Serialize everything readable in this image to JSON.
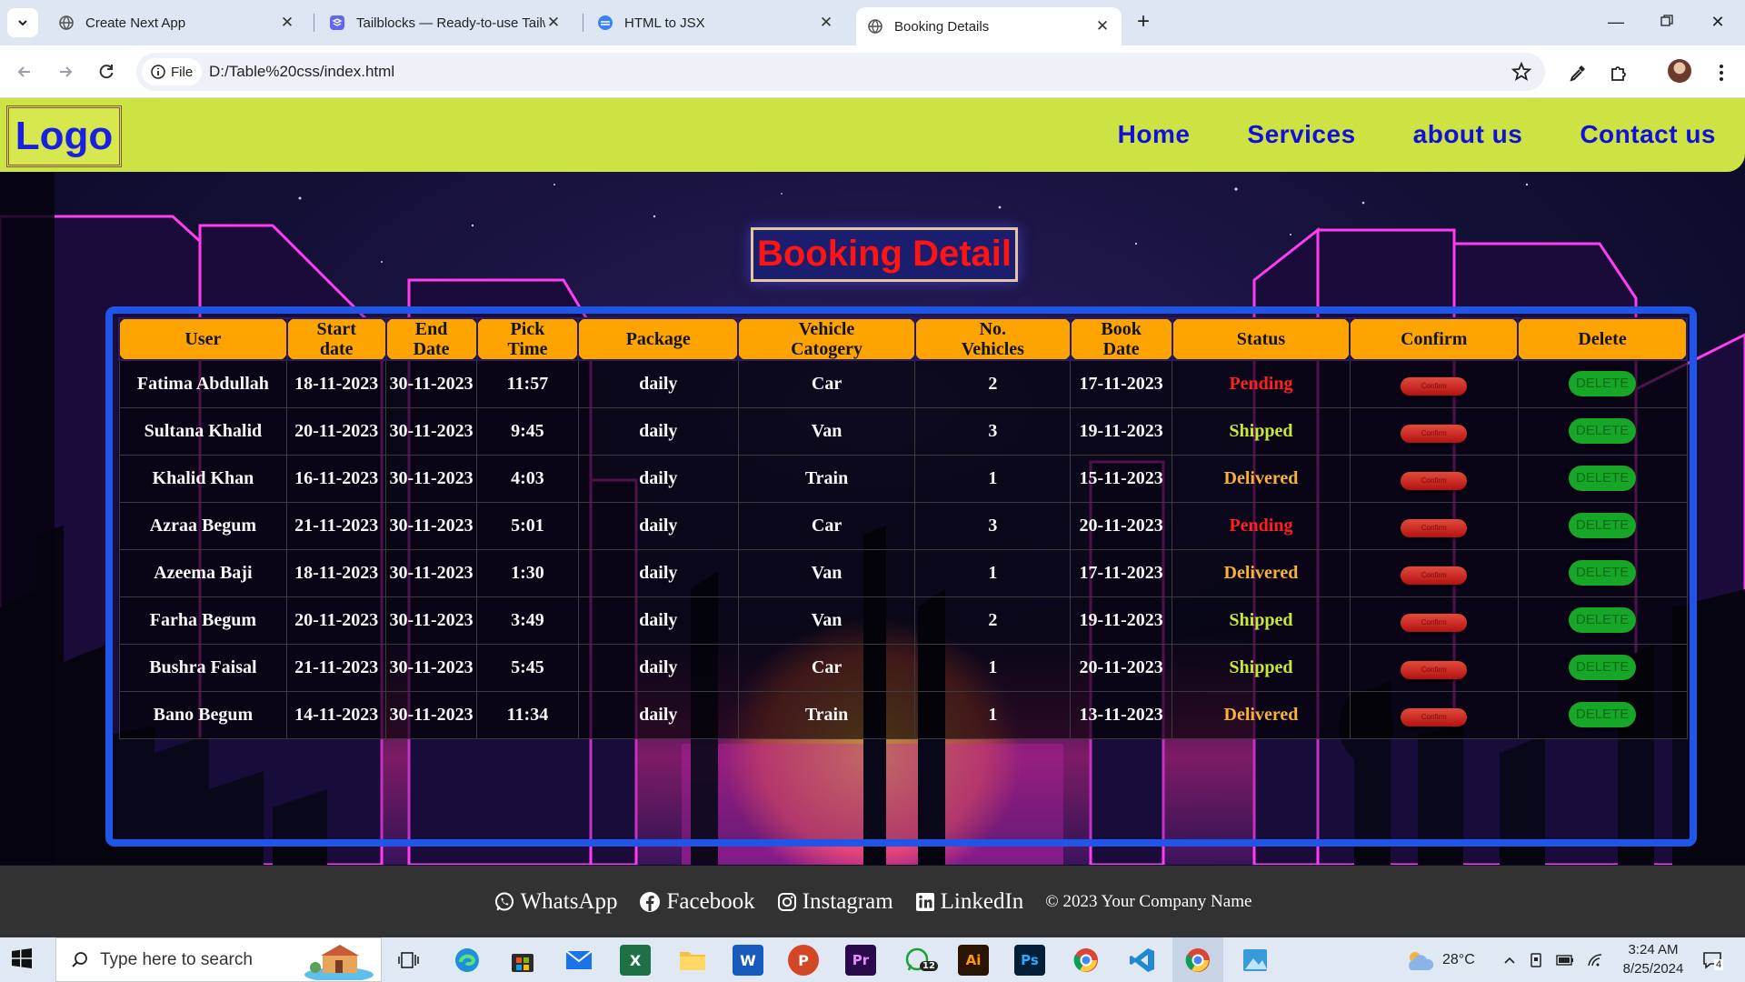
{
  "browser": {
    "tabs": [
      {
        "title": "Create Next App",
        "active": false
      },
      {
        "title": "Tailblocks — Ready-to-use Tailw",
        "active": false
      },
      {
        "title": "HTML to JSX",
        "active": false
      },
      {
        "title": "Booking Details",
        "active": true
      }
    ],
    "site_chip": "File",
    "url": "D:/Table%20css/index.html"
  },
  "site": {
    "logo": "Logo",
    "nav": [
      "Home",
      "Services",
      "about us",
      "Contact us"
    ],
    "page_title": "Booking Detail"
  },
  "table": {
    "headers": [
      [
        "User"
      ],
      [
        "Start",
        "date"
      ],
      [
        "End",
        "Date"
      ],
      [
        "Pick",
        "Time"
      ],
      [
        "Package"
      ],
      [
        "Vehicle",
        "Catogery"
      ],
      [
        "No.",
        "Vehicles"
      ],
      [
        "Book",
        "Date"
      ],
      [
        "Status"
      ],
      [
        "Confirm"
      ],
      [
        "Delete"
      ]
    ],
    "confirm_label": "Confirm",
    "delete_label": "DELETE",
    "rows": [
      {
        "user": "Fatima Abdullah",
        "start": "18-11-2023",
        "end": "30-11-2023",
        "time": "11:57",
        "package": "daily",
        "vehicle": "Car",
        "count": "2",
        "book": "17-11-2023",
        "status": "Pending"
      },
      {
        "user": "Sultana Khalid",
        "start": "20-11-2023",
        "end": "30-11-2023",
        "time": "9:45",
        "package": "daily",
        "vehicle": "Van",
        "count": "3",
        "book": "19-11-2023",
        "status": "Shipped"
      },
      {
        "user": "Khalid Khan",
        "start": "16-11-2023",
        "end": "30-11-2023",
        "time": "4:03",
        "package": "daily",
        "vehicle": "Train",
        "count": "1",
        "book": "15-11-2023",
        "status": "Delivered"
      },
      {
        "user": "Azraa Begum",
        "start": "21-11-2023",
        "end": "30-11-2023",
        "time": "5:01",
        "package": "daily",
        "vehicle": "Car",
        "count": "3",
        "book": "20-11-2023",
        "status": "Pending"
      },
      {
        "user": "Azeema Baji",
        "start": "18-11-2023",
        "end": "30-11-2023",
        "time": "1:30",
        "package": "daily",
        "vehicle": "Van",
        "count": "1",
        "book": "17-11-2023",
        "status": "Delivered"
      },
      {
        "user": "Farha Begum",
        "start": "20-11-2023",
        "end": "30-11-2023",
        "time": "3:49",
        "package": "daily",
        "vehicle": "Van",
        "count": "2",
        "book": "19-11-2023",
        "status": "Shipped"
      },
      {
        "user": "Bushra Faisal",
        "start": "21-11-2023",
        "end": "30-11-2023",
        "time": "5:45",
        "package": "daily",
        "vehicle": "Car",
        "count": "1",
        "book": "20-11-2023",
        "status": "Shipped"
      },
      {
        "user": "Bano Begum",
        "start": "14-11-2023",
        "end": "30-11-2023",
        "time": "11:34",
        "package": "daily",
        "vehicle": "Train",
        "count": "1",
        "book": "13-11-2023",
        "status": "Delivered"
      }
    ]
  },
  "footer": {
    "links": [
      "WhatsApp",
      "Facebook",
      "Instagram",
      "LinkedIn"
    ],
    "copyright": "© 2023 Your Company Name"
  },
  "taskbar": {
    "search_placeholder": "Type here to search",
    "whatsapp_badge": "12",
    "temperature": "28°C",
    "time": "3:24 AM",
    "date": "8/25/2024",
    "notifications": "4"
  },
  "colors": {
    "header_bg": "#cde243",
    "nav_text": "#1010d8",
    "title_red": "#ff1414",
    "table_header": "#fea400",
    "panel_border": "#1f55e8",
    "pending": "#ff2020",
    "shipped": "#c8e83c",
    "delivered": "#f7b23c"
  }
}
